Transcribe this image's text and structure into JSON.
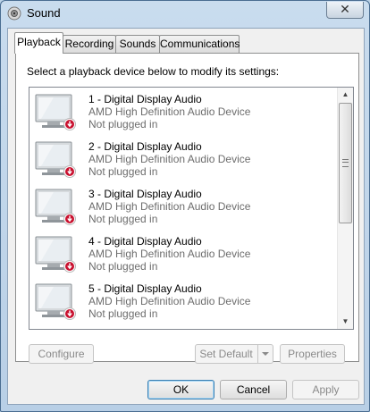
{
  "window": {
    "title": "Sound",
    "close_glyph": "✕"
  },
  "tabs": [
    {
      "label": "Playback",
      "active": true
    },
    {
      "label": "Recording",
      "active": false
    },
    {
      "label": "Sounds",
      "active": false
    },
    {
      "label": "Communications",
      "active": false
    }
  ],
  "playback": {
    "instruction": "Select a playback device below to modify its settings:",
    "devices": [
      {
        "name": "1 - Digital Display Audio",
        "description": "AMD High Definition Audio Device",
        "status": "Not plugged in",
        "icon": "monitor-icon"
      },
      {
        "name": "2 - Digital Display Audio",
        "description": "AMD High Definition Audio Device",
        "status": "Not plugged in",
        "icon": "monitor-icon"
      },
      {
        "name": "3 - Digital Display Audio",
        "description": "AMD High Definition Audio Device",
        "status": "Not plugged in",
        "icon": "monitor-icon"
      },
      {
        "name": "4 - Digital Display Audio",
        "description": "AMD High Definition Audio Device",
        "status": "Not plugged in",
        "icon": "monitor-icon"
      },
      {
        "name": "5 - Digital Display Audio",
        "description": "AMD High Definition Audio Device",
        "status": "Not plugged in",
        "icon": "monitor-icon"
      }
    ],
    "configure_label": "Configure",
    "set_default_label": "Set Default",
    "properties_label": "Properties"
  },
  "footer": {
    "ok_label": "OK",
    "cancel_label": "Cancel",
    "apply_label": "Apply"
  },
  "colors": {
    "status_badge": "#c8102e",
    "title_bar": "#bcd3e8"
  }
}
